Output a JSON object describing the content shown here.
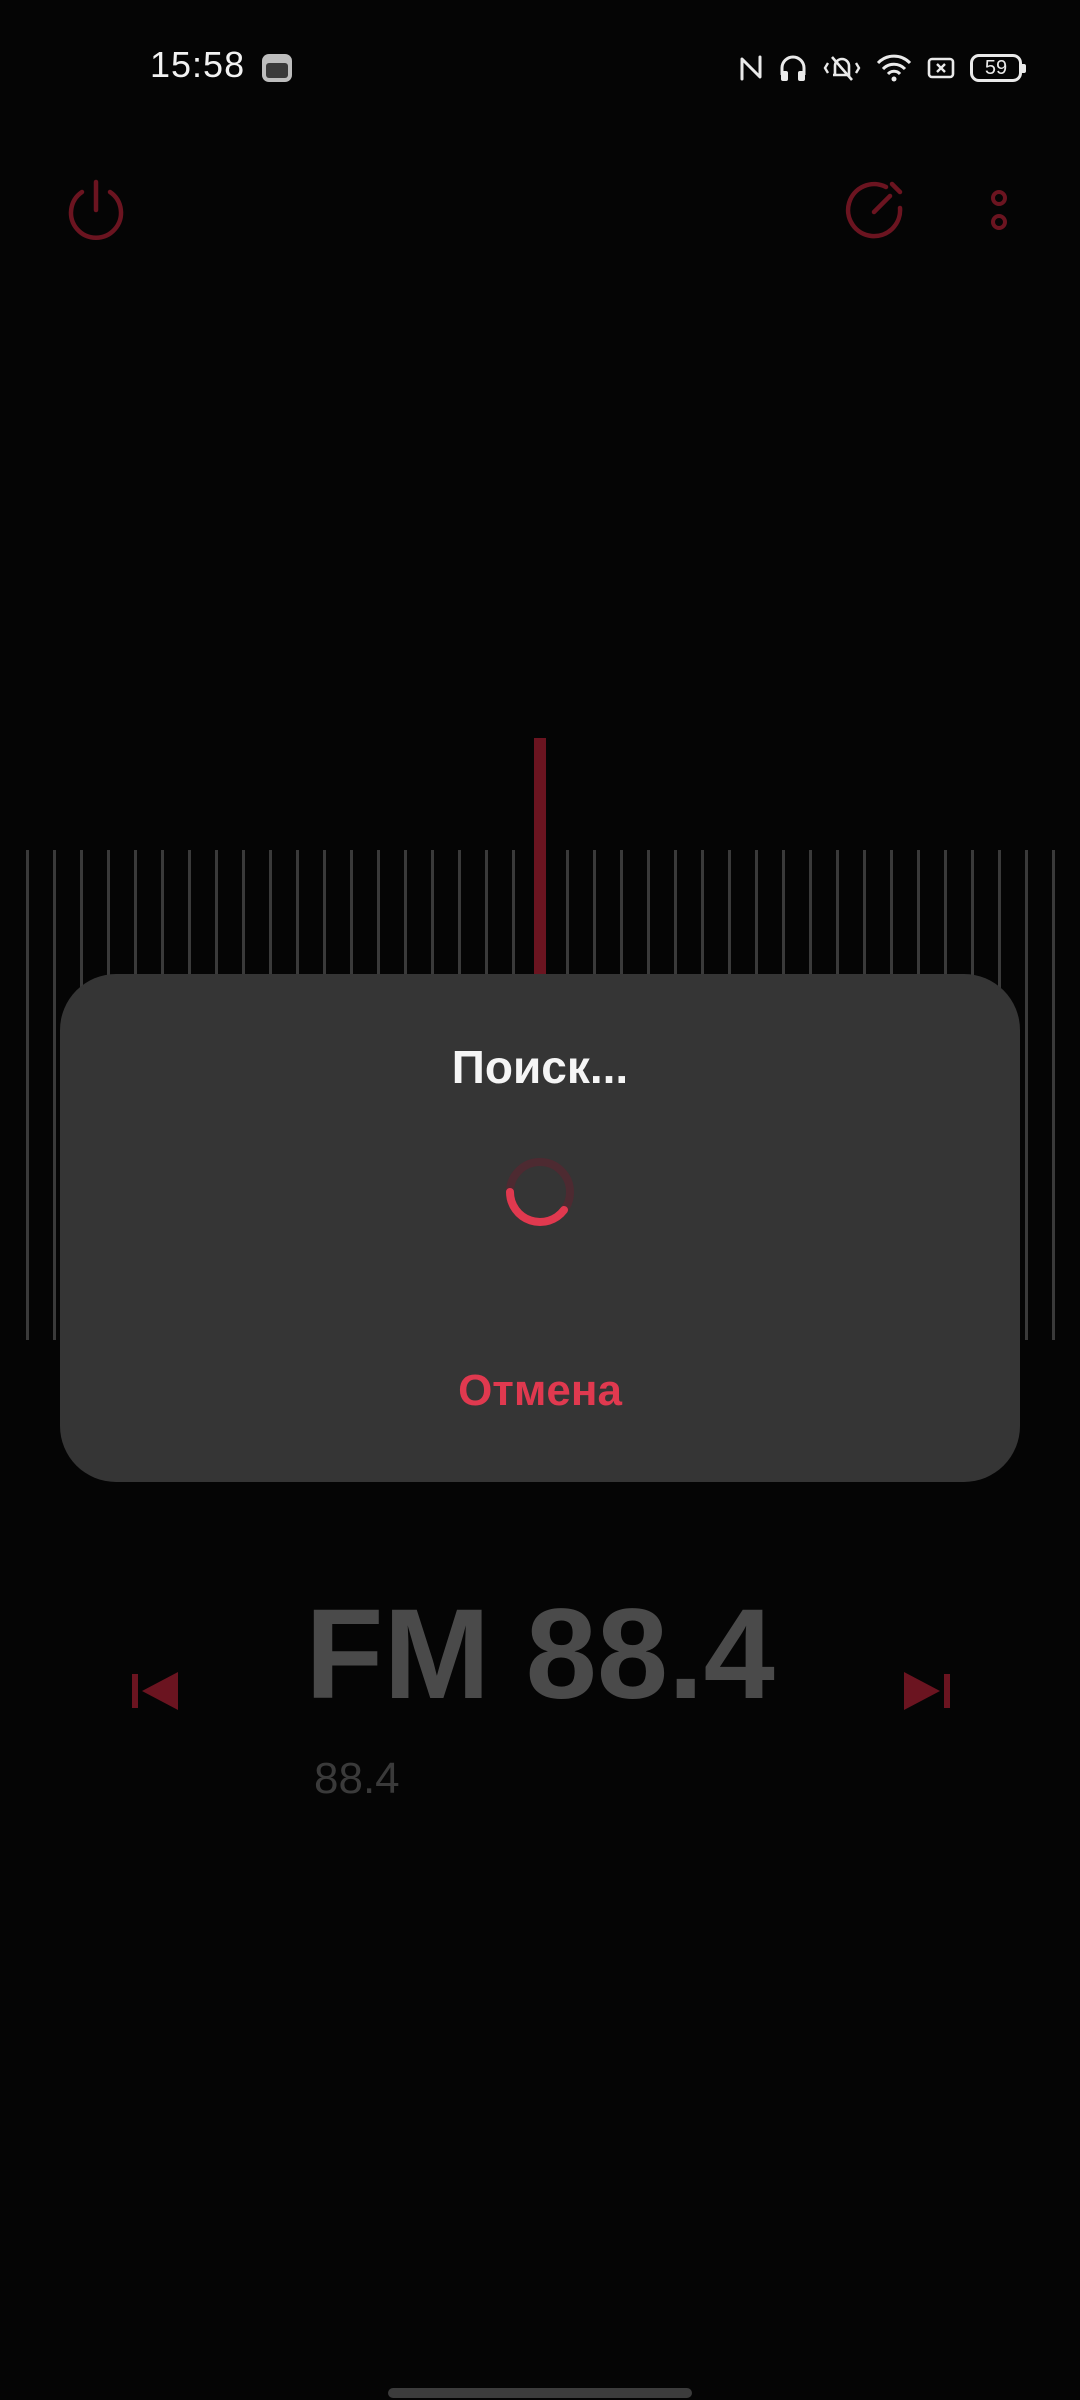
{
  "status_bar": {
    "time": "15:58",
    "battery_level": "59",
    "icons": [
      "app-notification-icon",
      "nfc-icon",
      "headphones-icon",
      "vibrate-silent-icon",
      "wifi-icon",
      "sim-icon",
      "battery-icon"
    ]
  },
  "toolbar": {
    "power_icon": "power-icon",
    "speed_icon": "speedometer-icon",
    "menu_icon": "more-vertical-icon"
  },
  "frequency": {
    "main_label": "FM 88.4",
    "sub_label": "88.4"
  },
  "navigation": {
    "previous_icon": "skip-previous-icon",
    "next_icon": "skip-next-icon"
  },
  "dialog": {
    "title": "Поиск...",
    "cancel_label": "Отмена",
    "spinner": "loading-spinner"
  },
  "colors": {
    "accent": "#e0394f",
    "accent_dim": "#6b1420",
    "dialog_bg": "#353535",
    "frequency_text": "#4a4a4a"
  }
}
